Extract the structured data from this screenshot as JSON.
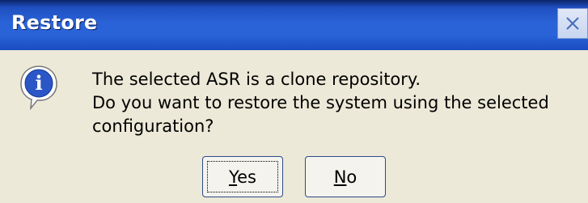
{
  "window": {
    "title": "Restore",
    "close_glyph": "×"
  },
  "icon": {
    "name": "info-icon",
    "glyph": "i",
    "colors": {
      "bubble": "#ffffff",
      "circle": "#2b56c6",
      "glyph": "#ffffff"
    }
  },
  "message": {
    "line1": "The selected ASR is a clone repository.",
    "line2": "Do you want to restore the system using the selected",
    "line3": "configuration?"
  },
  "buttons": {
    "yes": {
      "accel": "Y",
      "rest": "es"
    },
    "no": {
      "accel": "N",
      "rest": "o"
    }
  },
  "colors": {
    "titlebar": "#2a63d8",
    "background": "#ece9d8"
  }
}
